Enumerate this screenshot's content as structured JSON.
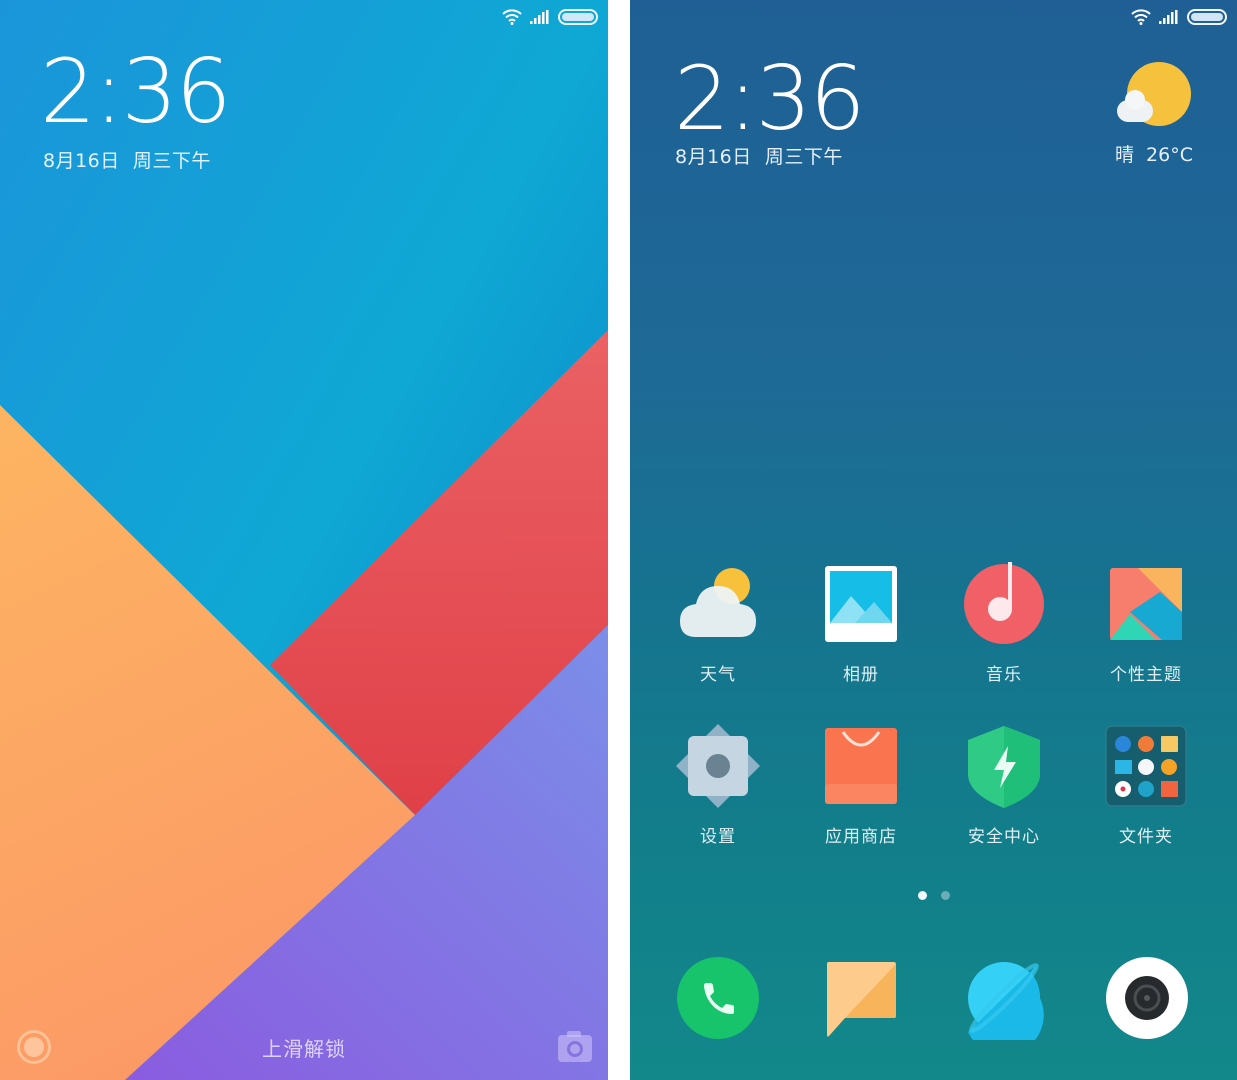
{
  "lock_screen": {
    "status_bar": {
      "wifi_icon": "wifi-icon",
      "signal_icon": "signal-icon",
      "battery_icon": "battery-icon"
    },
    "time": "2:36",
    "date": "8月16日  周三下午",
    "unlock_hint": "上滑解锁",
    "left_shortcut_icon": "flashlight-ring-icon",
    "right_shortcut_icon": "camera-icon",
    "wallpaper_colors": {
      "sky": "#1a9ad6",
      "orange": "#fba25f",
      "red": "#e85a5e",
      "purple": "#8a6ce0"
    }
  },
  "home_screen": {
    "status_bar": {
      "wifi_icon": "wifi-icon",
      "signal_icon": "signal-icon",
      "battery_icon": "battery-icon"
    },
    "time": "2:36",
    "date": "8月16日  周三下午",
    "weather": {
      "condition": "晴",
      "temperature": "26°C",
      "icon": "sun-cloud-icon"
    },
    "apps": [
      {
        "label": "天气",
        "icon": "weather-icon"
      },
      {
        "label": "相册",
        "icon": "gallery-icon"
      },
      {
        "label": "音乐",
        "icon": "music-icon"
      },
      {
        "label": "个性主题",
        "icon": "themes-icon"
      },
      {
        "label": "设置",
        "icon": "settings-icon"
      },
      {
        "label": "应用商店",
        "icon": "app-store-icon"
      },
      {
        "label": "安全中心",
        "icon": "security-icon"
      },
      {
        "label": "文件夹",
        "icon": "folder-icon"
      }
    ],
    "page_indicator": {
      "total": 2,
      "current": 1
    },
    "dock": [
      {
        "icon": "phone-icon",
        "color": "#17c36b"
      },
      {
        "icon": "messages-icon",
        "color": "#f8bb62"
      },
      {
        "icon": "browser-icon",
        "color": "#2ec7ef"
      },
      {
        "icon": "camera-icon",
        "color": "#ffffff"
      }
    ]
  }
}
